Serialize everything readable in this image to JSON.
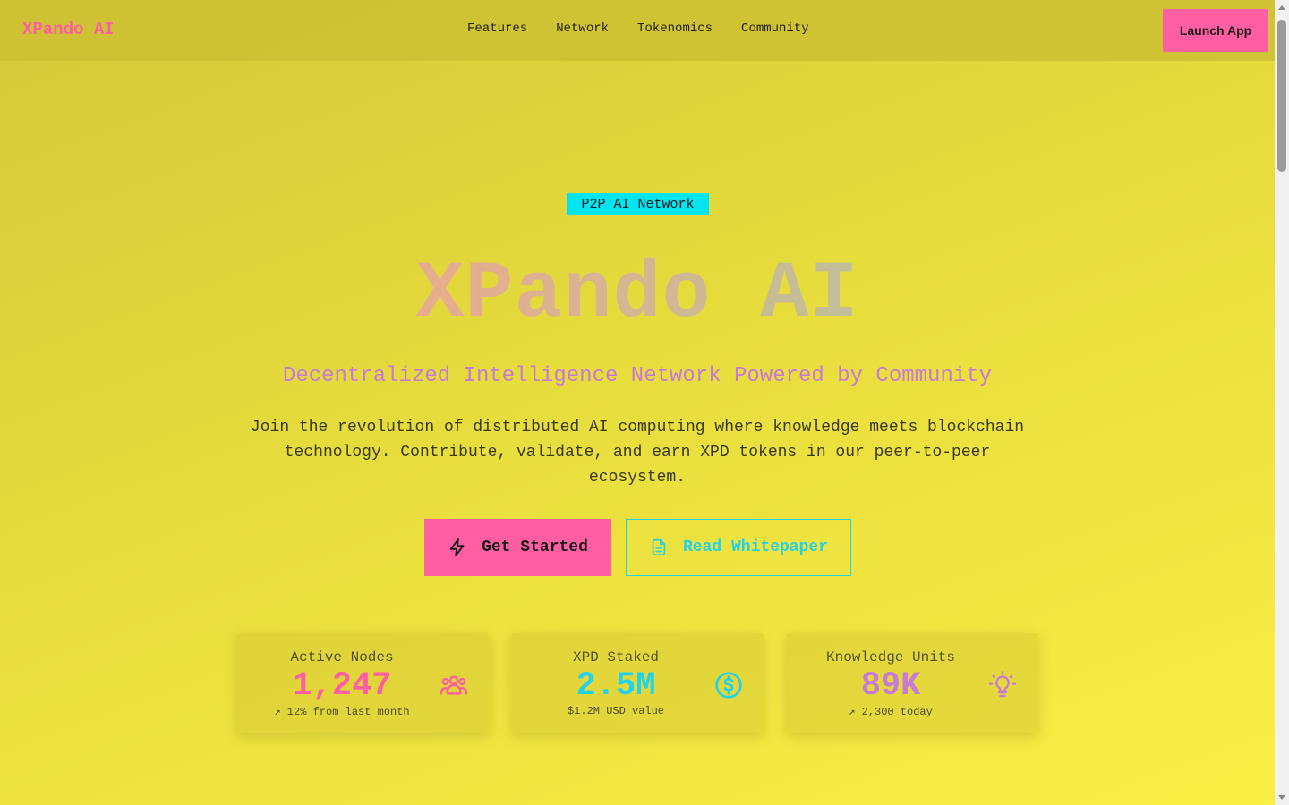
{
  "nav": {
    "logo": "XPando AI",
    "links": [
      "Features",
      "Network",
      "Tokenomics",
      "Community"
    ],
    "launch_label": "Launch App"
  },
  "hero": {
    "badge": "P2P AI Network",
    "title": "XPando AI",
    "subtitle": "Decentralized Intelligence Network Powered by Community",
    "description": "Join the revolution of distributed AI computing where knowledge meets blockchain technology. Contribute, validate, and earn XPD tokens in our peer-to-peer ecosystem.",
    "primary_label": "Get Started",
    "primary_icon": "lightning-icon",
    "secondary_label": "Read Whitepaper",
    "secondary_icon": "document-icon"
  },
  "stats": [
    {
      "label": "Active Nodes",
      "value": "1,247",
      "note": "↗ 12% from last month",
      "icon": "users-icon",
      "color": "#ff5fa2"
    },
    {
      "label": "XPD Staked",
      "value": "2.5M",
      "note": "$1.2M USD value",
      "icon": "dollar-icon",
      "color": "#22d3e8"
    },
    {
      "label": "Knowledge Units",
      "value": "89K",
      "note": "↗ 2,300 today",
      "icon": "lightbulb-icon",
      "color": "#c77ad8"
    }
  ],
  "colors": {
    "accent_pink": "#ff5fa2",
    "accent_cyan": "#22d3e8",
    "accent_purple": "#c77ad8"
  }
}
